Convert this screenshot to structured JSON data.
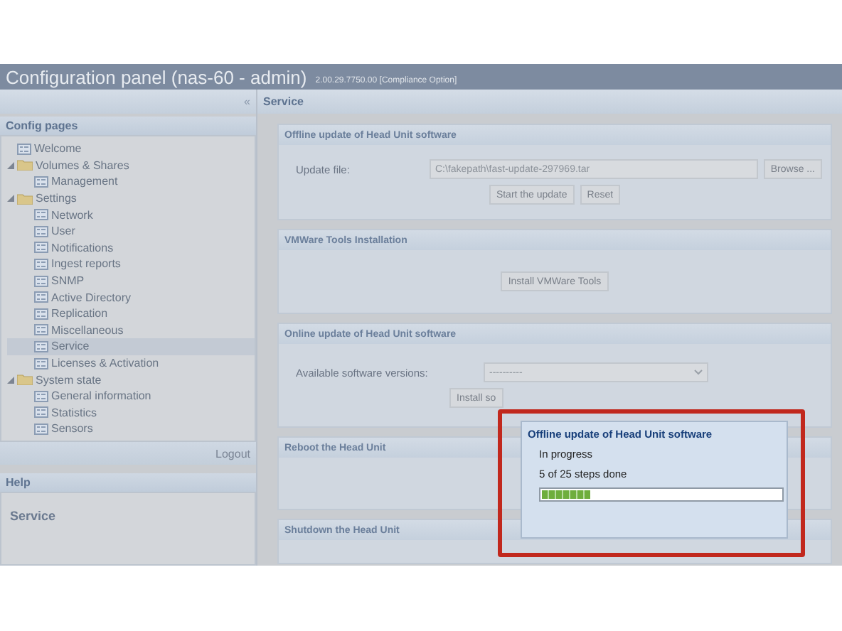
{
  "window": {
    "title": "Configuration panel (nas-60 - admin)",
    "version": "2.00.29.7750.00 [Compliance Option]"
  },
  "sidebar": {
    "collapse_glyph": "«",
    "title": "Config pages",
    "tree": [
      {
        "label": "Welcome",
        "kind": "page",
        "selected": false
      },
      {
        "label": "Volumes & Shares",
        "kind": "folder",
        "expanded": true,
        "selected": false,
        "children": [
          {
            "label": "Management",
            "kind": "page",
            "selected": false
          }
        ]
      },
      {
        "label": "Settings",
        "kind": "folder",
        "expanded": true,
        "selected": false,
        "children": [
          {
            "label": "Network",
            "kind": "page",
            "selected": false
          },
          {
            "label": "User",
            "kind": "page",
            "selected": false
          },
          {
            "label": "Notifications",
            "kind": "page",
            "selected": false
          },
          {
            "label": "Ingest reports",
            "kind": "page",
            "selected": false
          },
          {
            "label": "SNMP",
            "kind": "page",
            "selected": false
          },
          {
            "label": "Active Directory",
            "kind": "page",
            "selected": false
          },
          {
            "label": "Replication",
            "kind": "page",
            "selected": false
          },
          {
            "label": "Miscellaneous",
            "kind": "page",
            "selected": false
          },
          {
            "label": "Service",
            "kind": "page",
            "selected": true
          },
          {
            "label": "Licenses & Activation",
            "kind": "page",
            "selected": false
          }
        ]
      },
      {
        "label": "System state",
        "kind": "folder",
        "expanded": true,
        "selected": false,
        "children": [
          {
            "label": "General information",
            "kind": "page",
            "selected": false
          },
          {
            "label": "Statistics",
            "kind": "page",
            "selected": false
          },
          {
            "label": "Sensors",
            "kind": "page",
            "selected": false
          }
        ]
      }
    ],
    "logout": "Logout",
    "help_title": "Help",
    "help_heading": "Service"
  },
  "content": {
    "title": "Service",
    "panels": [
      {
        "kind": "file",
        "title": "Offline update of Head Unit software",
        "label": "Update file:",
        "value": "C:\\fakepath\\fast-update-297969.tar",
        "browse": "Browse ...",
        "buttons": [
          "Start the update",
          "Reset"
        ]
      },
      {
        "kind": "action",
        "title": "VMWare Tools Installation",
        "buttons": [
          "Install VMWare Tools"
        ]
      },
      {
        "kind": "select",
        "title": "Online update of Head Unit software",
        "label": "Available software versions:",
        "value": "----------",
        "buttons": [
          "Install so"
        ]
      },
      {
        "kind": "action",
        "title": "Reboot the Head Unit"
      },
      {
        "kind": "action",
        "title": "Shutdown the Head Unit"
      }
    ]
  },
  "dialog": {
    "title": "Offline update of Head Unit software",
    "status": "In progress",
    "steps": "5 of 25 steps done",
    "level": 0.2
  }
}
